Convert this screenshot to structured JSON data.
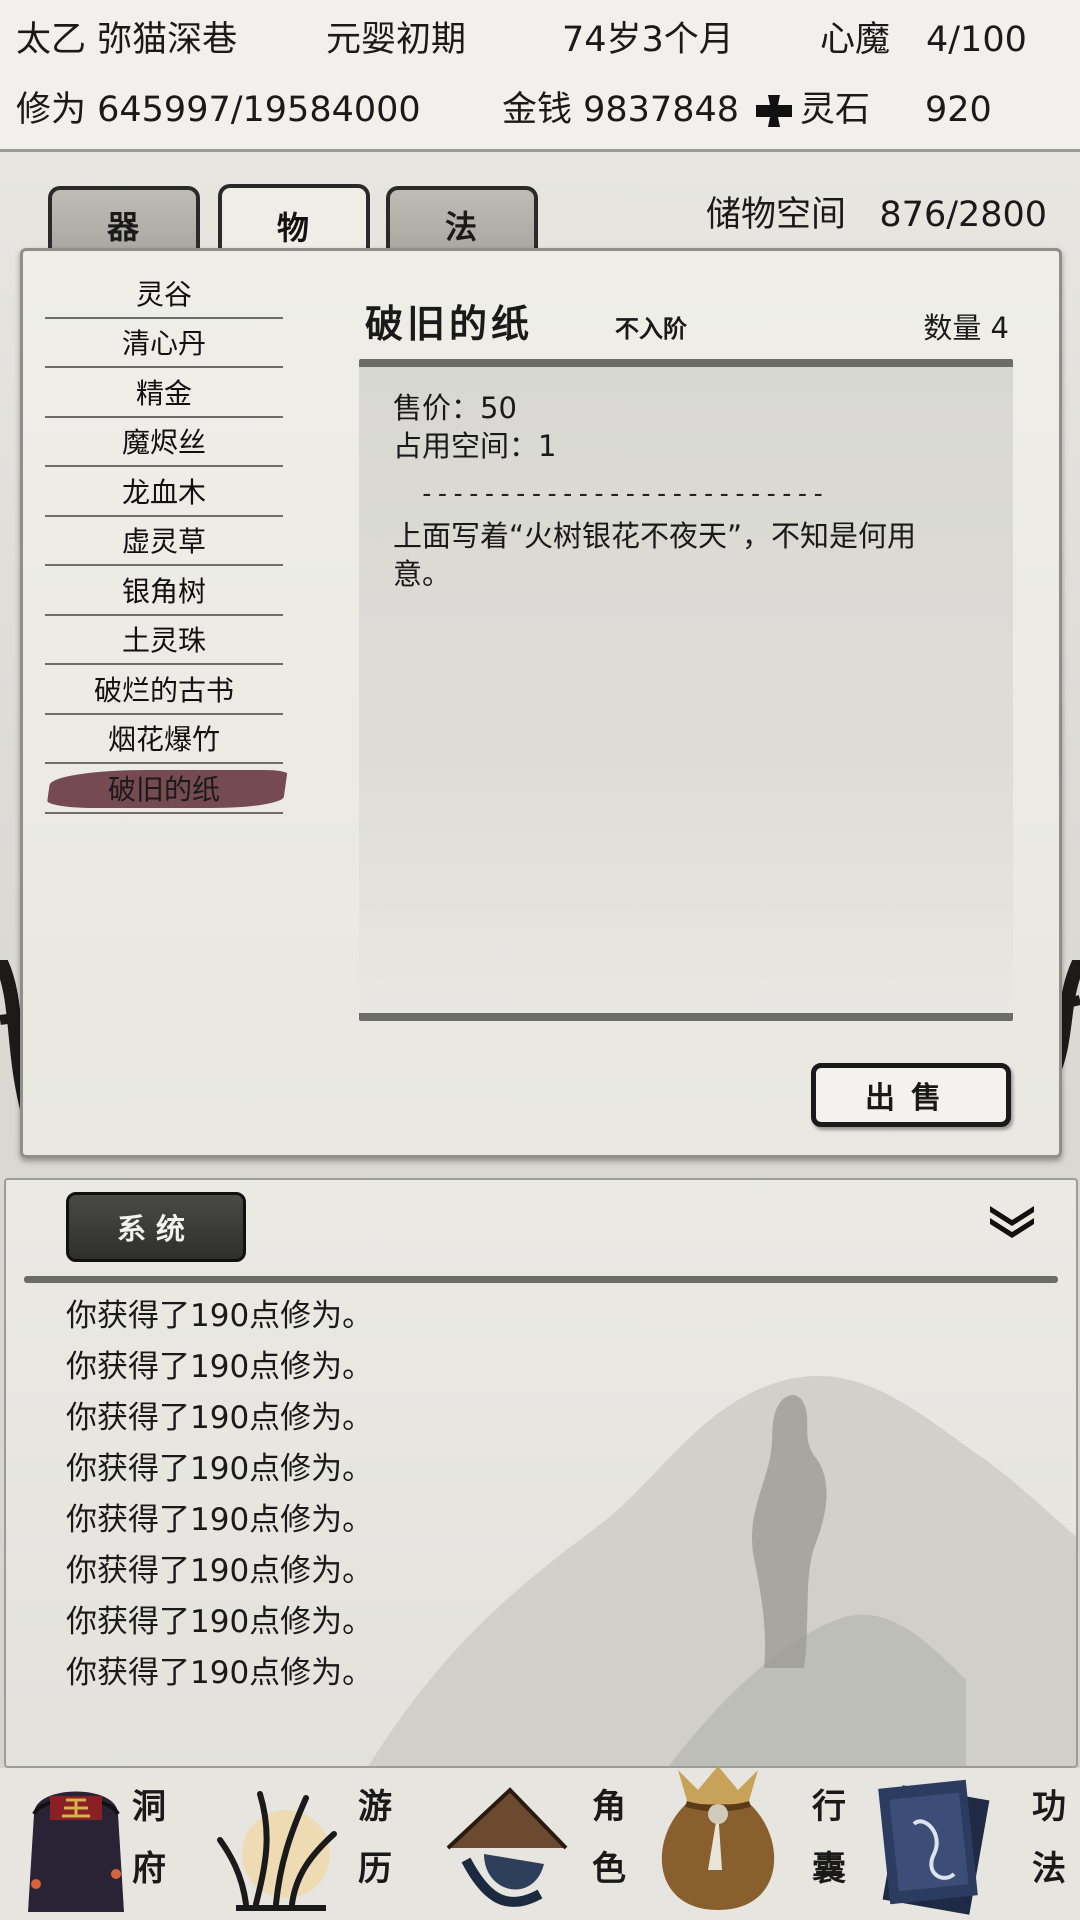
{
  "status": {
    "name": "太乙 弥猫深巷",
    "realm": "元婴初期",
    "age": "74岁3个月",
    "demon_label": "心魔",
    "demon_value": "4/100",
    "cultivation": "修为 645997/19584000",
    "money": "金钱 9837848",
    "stone_label": "灵石",
    "stone_value": "920"
  },
  "tabs": [
    {
      "label": "器",
      "active": false
    },
    {
      "label": "物",
      "active": true
    },
    {
      "label": "法",
      "active": false
    }
  ],
  "storage": {
    "label": "储物空间",
    "value": "876/2800"
  },
  "items": [
    {
      "label": "灵谷"
    },
    {
      "label": "清心丹"
    },
    {
      "label": "精金"
    },
    {
      "label": "魔烬丝"
    },
    {
      "label": "龙血木"
    },
    {
      "label": "虚灵草"
    },
    {
      "label": "银角树"
    },
    {
      "label": "土灵珠"
    },
    {
      "label": "破烂的古书"
    },
    {
      "label": "烟花爆竹"
    },
    {
      "label": "破旧的纸",
      "selected": true
    }
  ],
  "detail": {
    "name": "破旧的纸",
    "grade": "不入阶",
    "quantity": "数量 4",
    "price": "售价：50",
    "space": "占用空间：1",
    "separator": "--------------------------",
    "description": "上面写着“火树银花不夜天”，不知是何用意。",
    "sell_label": "出售"
  },
  "log": {
    "tab_label": "系统",
    "messages": [
      "你获得了190点修为。",
      "你获得了190点修为。",
      "你获得了190点修为。",
      "你获得了190点修为。",
      "你获得了190点修为。",
      "你获得了190点修为。",
      "你获得了190点修为。",
      "你获得了190点修为。"
    ]
  },
  "nav": [
    {
      "label1": "洞",
      "label2": "府",
      "icon": "cave-mansion-icon"
    },
    {
      "label1": "游",
      "label2": "历",
      "icon": "travel-icon"
    },
    {
      "label1": "角",
      "label2": "色",
      "icon": "character-icon"
    },
    {
      "label1": "行",
      "label2": "囊",
      "icon": "bag-icon"
    },
    {
      "label1": "功",
      "label2": "法",
      "icon": "manual-icon"
    }
  ],
  "colors": {
    "selected_item": "#6a3c44",
    "panel": "#efeee9",
    "blossom": "#c8323a"
  }
}
